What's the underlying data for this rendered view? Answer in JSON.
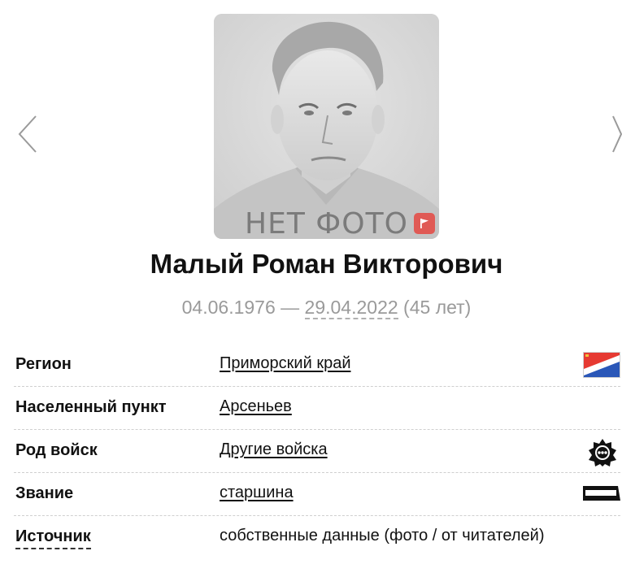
{
  "photo": {
    "caption": "НЕТ ФОТО"
  },
  "person": {
    "name": "Малый Роман Викторович",
    "birth_date": "04.06.1976",
    "separator": " — ",
    "death_date": "29.04.2022",
    "age": " (45 лет)"
  },
  "fields": {
    "region": {
      "label": "Регион",
      "value": "Приморский край",
      "icon": "region-flag-icon"
    },
    "settlement": {
      "label": "Населенный пункт",
      "value": "Арсеньев"
    },
    "branch": {
      "label": "Род войск",
      "value": "Другие войска",
      "icon": "branch-emblem-icon"
    },
    "rank": {
      "label": "Звание",
      "value": "старшина",
      "icon": "rank-insignia-icon"
    },
    "source": {
      "label": "Источник",
      "value": "собственные данные (фото / от читателей)"
    }
  },
  "colors": {
    "flag_badge": "#e05a55",
    "flag_red": "#e63a32",
    "flag_blue": "#2a57b8"
  }
}
